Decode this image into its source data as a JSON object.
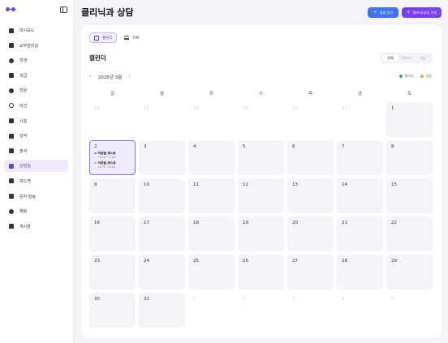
{
  "sidebar": {
    "items": [
      {
        "label": "대시보드",
        "icon": "dashboard-icon"
      },
      {
        "label": "교무관리실",
        "icon": "building-icon"
      },
      {
        "label": "학생",
        "icon": "student-icon"
      },
      {
        "label": "학급",
        "icon": "class-icon"
      },
      {
        "label": "직원",
        "icon": "staff-icon"
      },
      {
        "label": "미션",
        "icon": "mission-icon"
      },
      {
        "label": "시험",
        "icon": "exam-icon"
      },
      {
        "label": "성적",
        "icon": "grade-icon"
      },
      {
        "label": "출석",
        "icon": "attendance-icon"
      },
      {
        "label": "상담실",
        "icon": "consult-icon"
      },
      {
        "label": "피드백",
        "icon": "feedback-icon"
      },
      {
        "label": "문자 발송",
        "icon": "sms-icon"
      },
      {
        "label": "채팅",
        "icon": "chat-icon"
      },
      {
        "label": "게시판",
        "icon": "board-icon"
      }
    ],
    "active_index": 9
  },
  "header": {
    "title": "클리닉과 상담",
    "add_button": "일정 추가",
    "consult_button": "클리닉/상담 신청"
  },
  "view_tabs": {
    "calendar": "캘린더",
    "list": "목록"
  },
  "calendar": {
    "title": "캘린더",
    "filters": [
      "전체",
      "클리닉",
      "상담"
    ],
    "active_filter": 0,
    "month": "2026년 3월",
    "legend": [
      {
        "label": "클리닉",
        "color": "#27b3a0"
      },
      {
        "label": "상담",
        "color": "#f0a63a"
      }
    ],
    "weekdays": [
      "일",
      "월",
      "화",
      "수",
      "목",
      "금",
      "토"
    ],
    "days": [
      {
        "num": "26",
        "other": true
      },
      {
        "num": "27",
        "other": true
      },
      {
        "num": "28",
        "other": true
      },
      {
        "num": "29",
        "other": true
      },
      {
        "num": "30",
        "other": true
      },
      {
        "num": "31",
        "other": true
      },
      {
        "num": "1"
      },
      {
        "num": "2",
        "selected": true
      },
      {
        "num": "3"
      },
      {
        "num": "4"
      },
      {
        "num": "5"
      },
      {
        "num": "6"
      },
      {
        "num": "7"
      },
      {
        "num": "8"
      },
      {
        "num": "9"
      },
      {
        "num": "10"
      },
      {
        "num": "11"
      },
      {
        "num": "12"
      },
      {
        "num": "13"
      },
      {
        "num": "14"
      },
      {
        "num": "15"
      },
      {
        "num": "16"
      },
      {
        "num": "17"
      },
      {
        "num": "18"
      },
      {
        "num": "19"
      },
      {
        "num": "20"
      },
      {
        "num": "21"
      },
      {
        "num": "22"
      },
      {
        "num": "23"
      },
      {
        "num": "24"
      },
      {
        "num": "25"
      },
      {
        "num": "26"
      },
      {
        "num": "27"
      },
      {
        "num": "28"
      },
      {
        "num": "29"
      },
      {
        "num": "30"
      },
      {
        "num": "31"
      },
      {
        "num": "1",
        "other": true
      },
      {
        "num": "2",
        "other": true
      },
      {
        "num": "3",
        "other": true
      },
      {
        "num": "4",
        "other": true
      },
      {
        "num": "5",
        "other": true
      }
    ],
    "appointments": [
      {
        "name": "직원쌤_테스트",
        "time": "16:28~17:08",
        "color": "#27b3a0"
      },
      {
        "name": "직원쌤_테스트",
        "time": "16:28~17:08",
        "color": "#f0a63a"
      }
    ]
  },
  "colors": {
    "accent": "#6a3ff0",
    "primary_blue": "#3f73ef"
  }
}
